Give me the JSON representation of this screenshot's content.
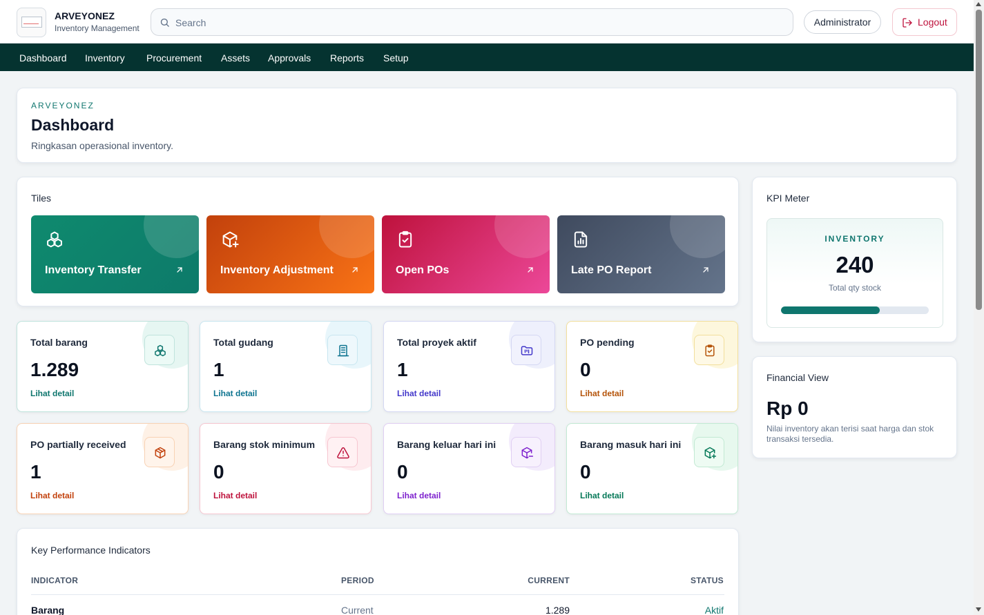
{
  "app": {
    "name": "ARVEYONEZ",
    "subtitle": "Inventory Management"
  },
  "search": {
    "placeholder": "Search",
    "value": ""
  },
  "user": {
    "role_button": "Administrator",
    "logout_label": "Logout"
  },
  "nav": [
    "Dashboard",
    "Inventory",
    "Procurement",
    "Assets",
    "Approvals",
    "Reports",
    "Setup"
  ],
  "header": {
    "eyebrow": "ARVEYONEZ",
    "title": "Dashboard",
    "description": "Ringkasan operasional inventory."
  },
  "tiles": {
    "title": "Tiles",
    "items": [
      {
        "label": "Inventory Transfer",
        "icon": "boxes-icon",
        "color_from": "#0f8a6e",
        "color_to": "#0d7a6a"
      },
      {
        "label": "Inventory Adjustment",
        "icon": "package-plus-icon",
        "color_from": "#c2410c",
        "color_to": "#f97316"
      },
      {
        "label": "Open POs",
        "icon": "clipboard-check-icon",
        "color_from": "#be123c",
        "color_to": "#ec4899"
      },
      {
        "label": "Late PO Report",
        "icon": "file-chart-icon",
        "color_from": "#3f4a5e",
        "color_to": "#64748b"
      }
    ]
  },
  "stats": [
    {
      "label": "Total barang",
      "value": "1.289",
      "link": "Lihat detail",
      "icon": "boxes-icon",
      "accent": "#0f766e"
    },
    {
      "label": "Total gudang",
      "value": "1",
      "link": "Lihat detail",
      "icon": "building-icon",
      "accent": "#0e7490"
    },
    {
      "label": "Total proyek aktif",
      "value": "1",
      "link": "Lihat detail",
      "icon": "folder-kanban-icon",
      "accent": "#4338ca"
    },
    {
      "label": "PO pending",
      "value": "0",
      "link": "Lihat detail",
      "icon": "clipboard-check-icon",
      "accent": "#b45309"
    },
    {
      "label": "PO partially received",
      "value": "1",
      "link": "Lihat detail",
      "icon": "package-open-icon",
      "accent": "#c2410c"
    },
    {
      "label": "Barang stok minimum",
      "value": "0",
      "link": "Lihat detail",
      "icon": "alert-triangle-icon",
      "accent": "#be123c"
    },
    {
      "label": "Barang keluar hari ini",
      "value": "0",
      "link": "Lihat detail",
      "icon": "package-minus-icon",
      "accent": "#7e22ce"
    },
    {
      "label": "Barang masuk hari ini",
      "value": "0",
      "link": "Lihat detail",
      "icon": "package-plus-icon",
      "accent": "#047857"
    }
  ],
  "kpi_meter": {
    "title": "KPI Meter",
    "label": "INVENTORY",
    "value": "240",
    "subtitle": "Total qty stock",
    "progress_percent": 67
  },
  "financial": {
    "title": "Financial View",
    "value": "Rp 0",
    "note": "Nilai inventory akan terisi saat harga dan stok transaksi tersedia."
  },
  "kpi_table": {
    "title": "Key Performance Indicators",
    "columns": [
      "INDICATOR",
      "PERIOD",
      "CURRENT",
      "STATUS"
    ],
    "rows": [
      {
        "indicator": "Barang",
        "period": "Current",
        "current": "1.289",
        "status": "Aktif"
      }
    ]
  }
}
